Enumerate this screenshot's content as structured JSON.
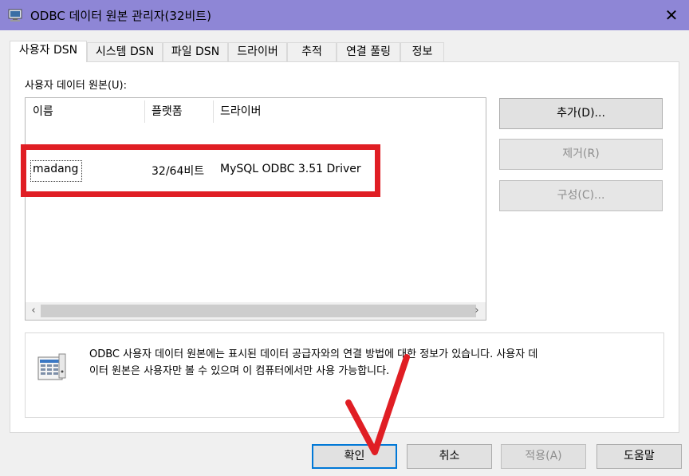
{
  "window": {
    "title": "ODBC 데이터 원본 관리자(32비트)",
    "close_glyph": "✕"
  },
  "tabs": [
    {
      "label": "사용자 DSN",
      "active": true
    },
    {
      "label": "시스템 DSN",
      "active": false
    },
    {
      "label": "파일 DSN",
      "active": false
    },
    {
      "label": "드라이버",
      "active": false
    },
    {
      "label": "추적",
      "active": false
    },
    {
      "label": "연결 풀링",
      "active": false
    },
    {
      "label": "정보",
      "active": false
    }
  ],
  "user_dsn": {
    "group_label": "사용자 데이터 원본(U):",
    "columns": [
      "이름",
      "플랫폼",
      "드라이버"
    ],
    "rows": [
      {
        "name": "madang",
        "platform": "32/64비트",
        "driver": "MySQL ODBC 3.51 Driver",
        "selected": true
      }
    ],
    "scroll_left": "‹",
    "scroll_right": "›"
  },
  "actions": {
    "add_label": "추가(D)...",
    "remove_label": "제거(R)",
    "configure_label": "구성(C)..."
  },
  "info": {
    "line1": "ODBC 사용자 데이터 원본에는 표시된 데이터 공급자와의 연결 방법에 대한 정보가 있습니다. 사용자 데",
    "line2": "이터 원본은 사용자만 볼 수 있으며 이 컴퓨터에서만 사용 가능합니다."
  },
  "footer": {
    "ok_label": "확인",
    "cancel_label": "취소",
    "apply_label": "적용(A)",
    "help_label": "도움말"
  },
  "colors": {
    "titlebar": "#8e86d6",
    "annotation_red": "#e01e24",
    "default_button_border": "#0078d7"
  }
}
